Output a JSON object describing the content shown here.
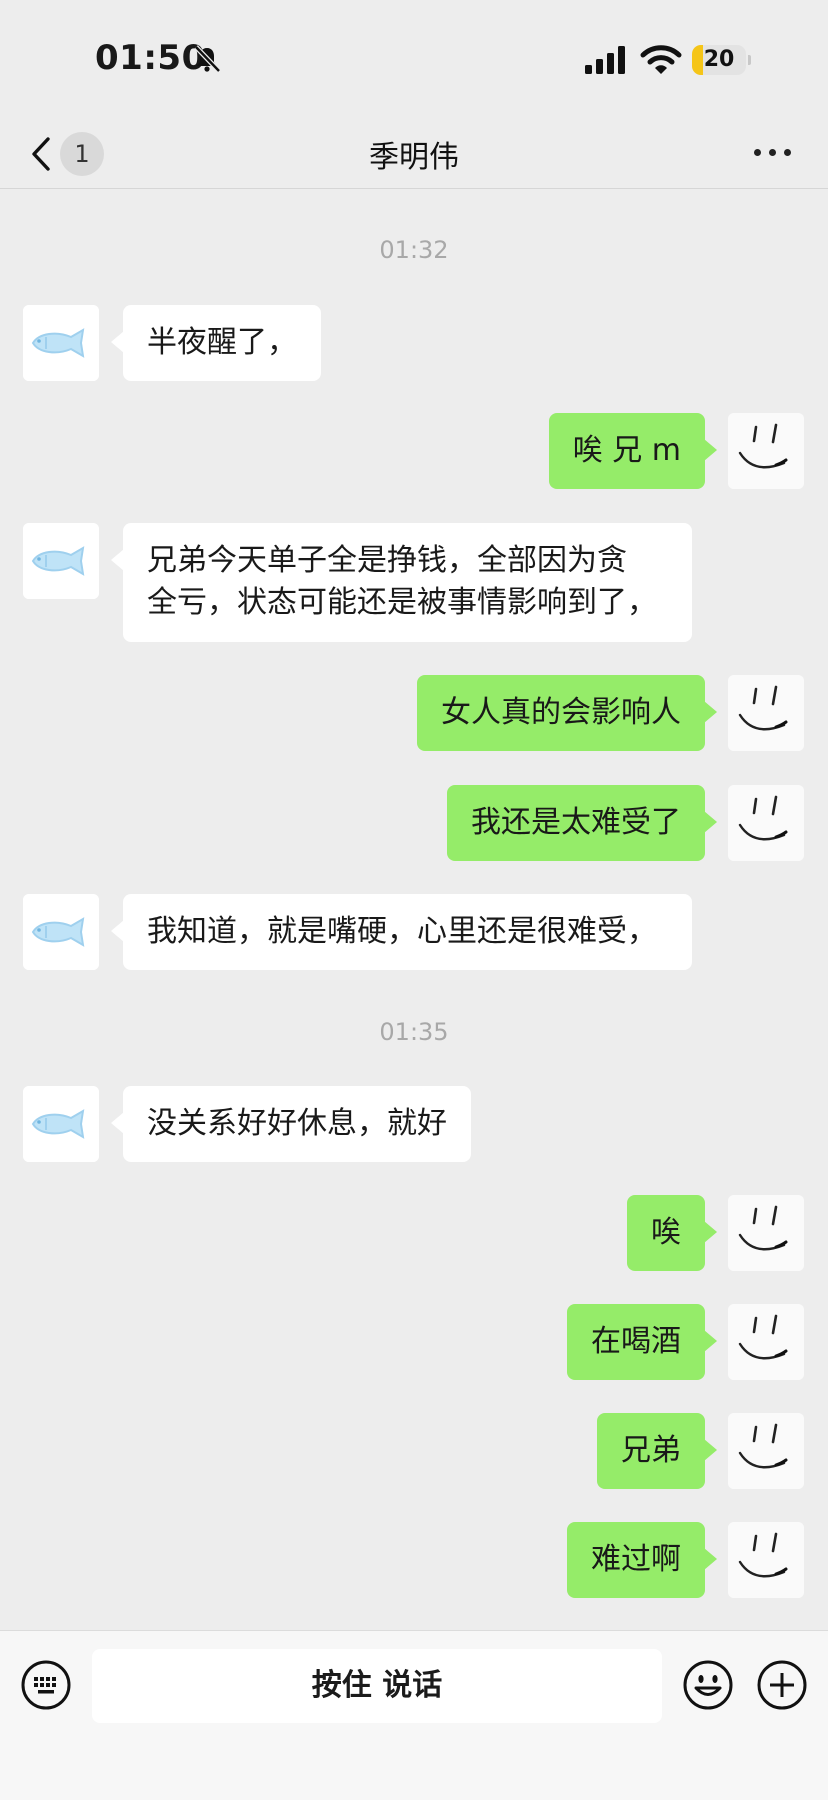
{
  "status_bar": {
    "time": "01:50",
    "battery_level": "20",
    "battery_fraction": 0.2,
    "battery_color": "#f5c518",
    "icons": [
      "bell-slash-icon",
      "cellular-signal-icon",
      "wifi-icon",
      "battery-icon"
    ]
  },
  "nav": {
    "back_icon": "chevron-left-icon",
    "unread_count": "1",
    "title": "季明伟",
    "more_icon": "more-dots-icon"
  },
  "colors": {
    "background": "#ededed",
    "bubble_incoming": "#ffffff",
    "bubble_outgoing": "#95ec69",
    "timestamp": "#a8a8a8"
  },
  "timestamps": [
    "01:32",
    "01:35"
  ],
  "messages": [
    {
      "side": "left",
      "text": "半夜醒了，"
    },
    {
      "side": "right",
      "text": "唉 兄 m"
    },
    {
      "side": "left",
      "text": "兄弟今天单子全是挣钱，全部因为贪\n全亏，状态可能还是被事情影响到了，"
    },
    {
      "side": "right",
      "text": "女人真的会影响人"
    },
    {
      "side": "right",
      "text": "我还是太难受了"
    },
    {
      "side": "left",
      "text": "我知道，就是嘴硬，心里还是很难受，"
    },
    {
      "side": "left",
      "text": "没关系好好休息，就好"
    },
    {
      "side": "right",
      "text": "唉"
    },
    {
      "side": "right",
      "text": "在喝酒"
    },
    {
      "side": "right",
      "text": "兄弟"
    },
    {
      "side": "right",
      "text": "难过啊"
    }
  ],
  "avatars": {
    "left_icon": "fish-avatar-icon",
    "right_icon": "smiley-sketch-avatar-icon"
  },
  "input_bar": {
    "keyboard_icon": "keyboard-icon",
    "hold_to_talk_label": "按住 说话",
    "emoji_icon": "emoji-icon",
    "add_icon": "plus-circle-icon"
  }
}
